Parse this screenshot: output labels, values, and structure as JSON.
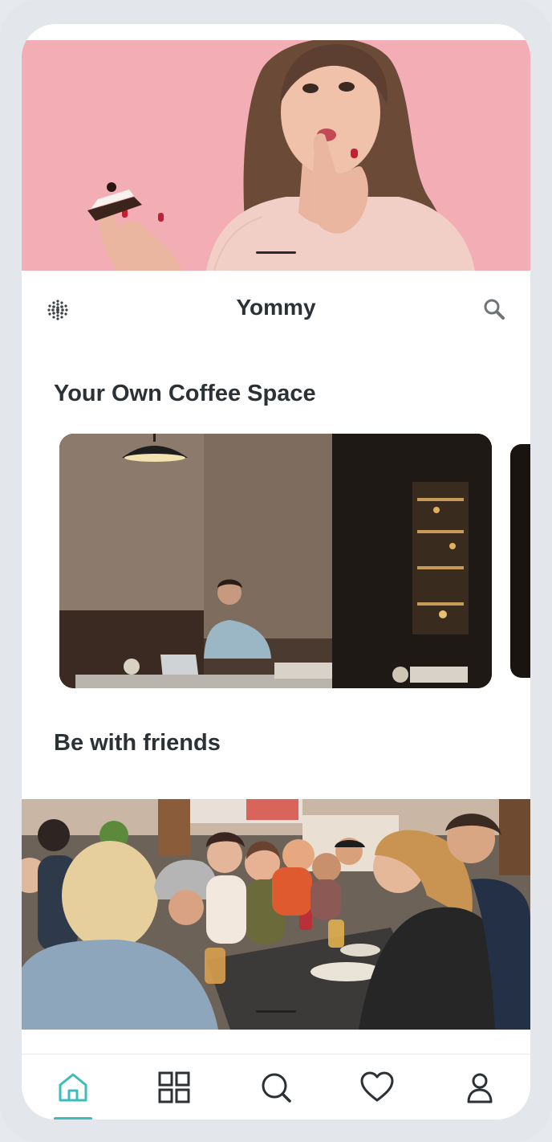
{
  "app": {
    "title": "Yommy"
  },
  "sections": {
    "coffee_title": "Your Own Coffee Space",
    "friends_title": "Be with friends"
  },
  "icons": {
    "menu": "dots-grid-icon",
    "search": "search-icon"
  },
  "bottom_nav": {
    "items": [
      {
        "name": "home",
        "icon": "home-icon",
        "active": true
      },
      {
        "name": "categories",
        "icon": "grid-icon",
        "active": false
      },
      {
        "name": "search",
        "icon": "search-icon",
        "active": false
      },
      {
        "name": "favorites",
        "icon": "heart-icon",
        "active": false
      },
      {
        "name": "profile",
        "icon": "user-icon",
        "active": false
      }
    ]
  },
  "colors": {
    "accent": "#3ebcbc",
    "text_dark": "#2c3136",
    "hero_bg": "#f1aab1"
  }
}
